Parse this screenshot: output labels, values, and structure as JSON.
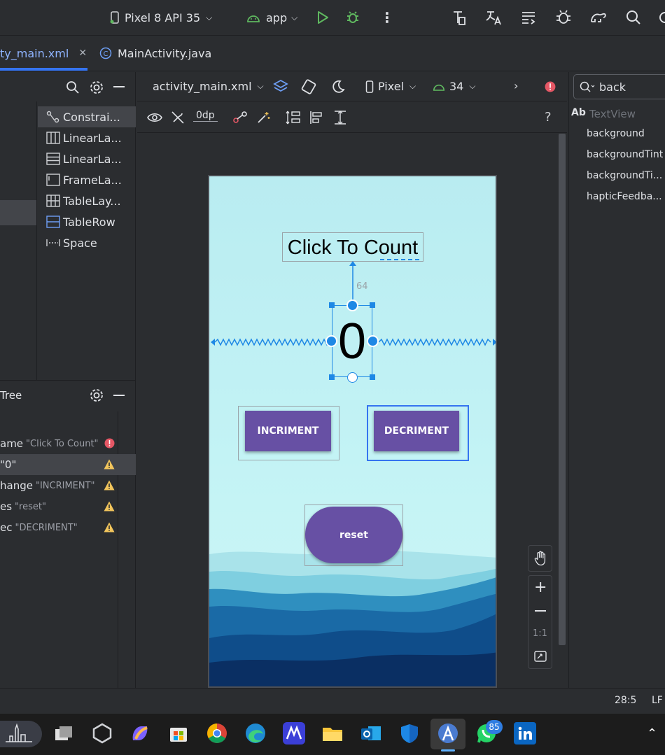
{
  "toolbar": {
    "device": "Pixel 8 API 35",
    "run_config": "app"
  },
  "tabs": [
    {
      "label": "ty_main.xml",
      "active": true
    },
    {
      "label": "MainActivity.java",
      "active": false
    }
  ],
  "palette": {
    "items": [
      "Constrai...",
      "LinearLa...",
      "LinearLa...",
      "FrameLa...",
      "TableLay...",
      "TableRow",
      "Space"
    ]
  },
  "component_tree": {
    "title": "Tree",
    "rows": [
      {
        "name": "ame",
        "text": "\"Click To Count\"",
        "status": "error"
      },
      {
        "name": "\"0\"",
        "text": "",
        "status": "warning"
      },
      {
        "name": "hange",
        "text": "\"INCRIMENT\"",
        "status": "warning"
      },
      {
        "name": "es",
        "text": "\"reset\"",
        "status": "warning"
      },
      {
        "name": "ec",
        "text": "\"DECRIMENT\"",
        "status": "warning"
      }
    ]
  },
  "design": {
    "file": "activity_main.xml",
    "device": "Pixel",
    "api": "34",
    "margin_default": "0dp"
  },
  "preview": {
    "title": "Click To Count",
    "counter": "0",
    "constraint_margin": "64",
    "increment_label": "INCRIMENT",
    "decrement_label": "DECRIMENT",
    "reset_label": "reset"
  },
  "zoom_controls": {
    "fit_label": "1:1"
  },
  "attributes": {
    "search_value": "back",
    "section": "TextView",
    "section_prefix": "Ab",
    "items": [
      "background",
      "backgroundTint",
      "backgroundTi...",
      "hapticFeedba..."
    ]
  },
  "status": {
    "position": "28:5",
    "line_sep": "LF"
  },
  "taskbar": {
    "whatsapp_badge": "85"
  },
  "colors": {
    "accent": "#3574f0",
    "button": "#6750a4",
    "error": "#e55765",
    "warning": "#f2c55c",
    "selection": "#1e88e5"
  }
}
